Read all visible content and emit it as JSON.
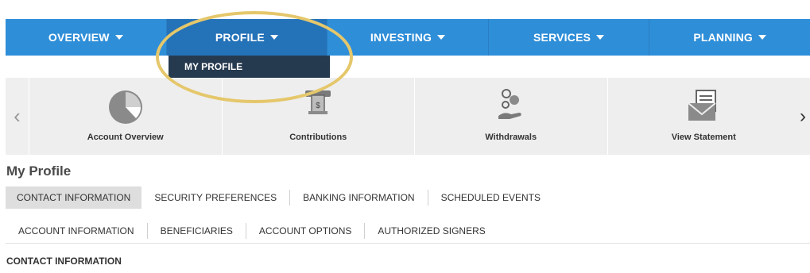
{
  "nav": {
    "items": [
      {
        "label": "OVERVIEW"
      },
      {
        "label": "PROFILE"
      },
      {
        "label": "INVESTING"
      },
      {
        "label": "SERVICES"
      },
      {
        "label": "PLANNING"
      }
    ],
    "dropdown_item": "MY PROFILE"
  },
  "carousel": {
    "tiles": [
      {
        "label": "Account Overview",
        "icon": "pie-chart-icon"
      },
      {
        "label": "Contributions",
        "icon": "money-deposit-icon"
      },
      {
        "label": "Withdrawals",
        "icon": "coins-hand-icon"
      },
      {
        "label": "View Statement",
        "icon": "envelope-statement-icon"
      }
    ],
    "left_arrow": "‹",
    "right_arrow": "›"
  },
  "page": {
    "title": "My Profile",
    "tabs_primary": [
      {
        "label": "CONTACT INFORMATION"
      },
      {
        "label": "SECURITY PREFERENCES"
      },
      {
        "label": "BANKING INFORMATION"
      },
      {
        "label": "SCHEDULED EVENTS"
      }
    ],
    "tabs_secondary": [
      {
        "label": "ACCOUNT INFORMATION"
      },
      {
        "label": "BENEFICIARIES"
      },
      {
        "label": "ACCOUNT OPTIONS"
      },
      {
        "label": "AUTHORIZED SIGNERS"
      }
    ],
    "section_title": "CONTACT INFORMATION"
  },
  "colors": {
    "nav_bg": "#2f8ed8",
    "nav_active": "#2472b8",
    "dropdown_bg": "#263a4f",
    "highlight_ring": "#e5c76b"
  }
}
